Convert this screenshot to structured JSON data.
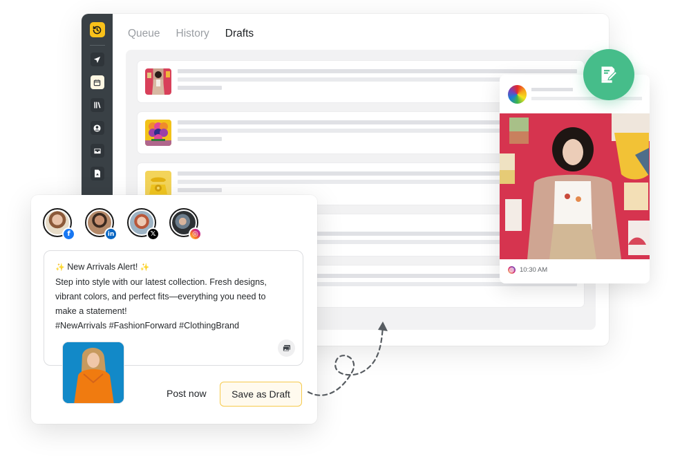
{
  "app": {
    "tabs": [
      {
        "label": "Queue",
        "active": false
      },
      {
        "label": "History",
        "active": false
      },
      {
        "label": "Drafts",
        "active": true
      }
    ],
    "sidebar": {
      "logo_icon": "clock-history-icon",
      "items": [
        {
          "icon": "send-icon",
          "active": false
        },
        {
          "icon": "calendar-icon",
          "active": true
        },
        {
          "icon": "library-icon",
          "active": false
        },
        {
          "icon": "user-circle-icon",
          "active": false
        },
        {
          "icon": "inbox-icon",
          "active": false
        },
        {
          "icon": "document-icon",
          "active": false
        }
      ]
    },
    "drafts": [
      {
        "thumbnail": "woman-red-wall-thumb"
      },
      {
        "thumbnail": "colorful-circles-thumb"
      },
      {
        "thumbnail": "yellow-telephone-thumb"
      },
      {
        "thumbnail": ""
      },
      {
        "thumbnail": ""
      }
    ]
  },
  "preview": {
    "platform_icon": "instagram-icon",
    "time": "10:30 AM",
    "image": "woman-in-blazer-red-wall"
  },
  "fab": {
    "icon": "edit-note-icon"
  },
  "composer": {
    "accounts": [
      {
        "network": "facebook",
        "badge": "f",
        "color": "#1877f2"
      },
      {
        "network": "linkedin",
        "badge": "in",
        "color": "#0a66c2"
      },
      {
        "network": "x",
        "badge": "𝕏",
        "color": "#000000"
      },
      {
        "network": "instagram",
        "badge": "◎",
        "color": "#e1306c"
      }
    ],
    "post_lines": [
      {
        "sparkle": true,
        "text": " New Arrivals Alert! "
      },
      {
        "sparkle": false,
        "text": "Step into style with our latest collection. Fresh designs,"
      },
      {
        "sparkle": false,
        "text": "vibrant colors, and perfect fits—everything you need to"
      },
      {
        "sparkle": false,
        "text": "make a statement!"
      },
      {
        "sparkle": false,
        "text": "#NewArrivals #FashionForward #ClothingBrand"
      }
    ],
    "sparkle_glyph": "✨",
    "post_now_label": "Post now",
    "save_draft_label": "Save as Draft"
  },
  "colors": {
    "brand_yellow": "#f9c11a",
    "sidebar": "#394045",
    "fab_green": "#46bd8a",
    "draft_border": "#f6c94a"
  }
}
